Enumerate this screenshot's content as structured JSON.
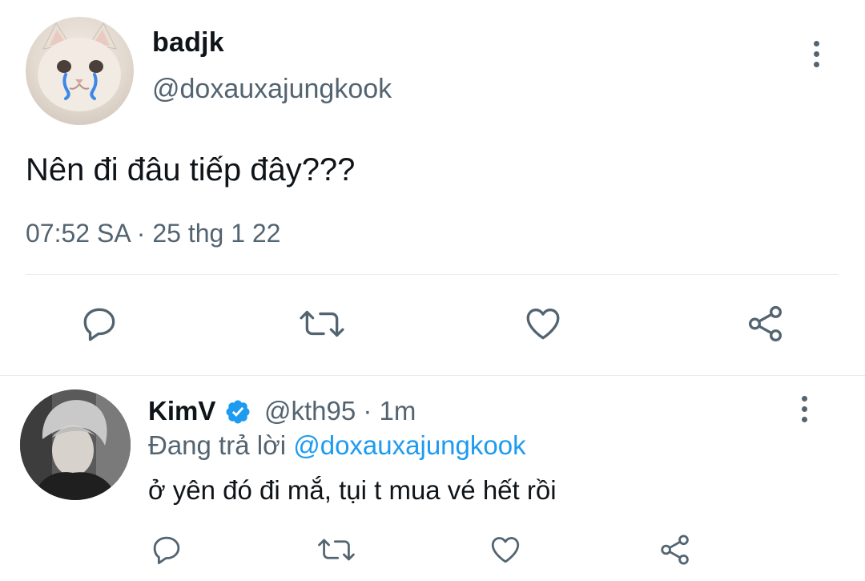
{
  "tweet": {
    "display_name": "badjk",
    "handle": "@doxauxajungkook",
    "text": "Nên đi đâu tiếp đây???",
    "timestamp": "07:52 SA · 25 thg 1 22"
  },
  "reply": {
    "display_name": "KimV",
    "handle_time": "@kth95 · 1m",
    "replying_prefix": "Đang trả lời",
    "replying_to": "@doxauxajungkook",
    "text": "ở yên đó đi mắ, tụi t mua vé hết rồi"
  },
  "icons": {
    "reply": "comment-icon",
    "retweet": "retweet-icon",
    "like": "heart-icon",
    "share": "share-icon",
    "more": "more-vertical-icon",
    "verified": "verified-badge-icon"
  },
  "colors": {
    "icon": "#536471",
    "link": "#1d9bf0",
    "verified": "#1d9bf0"
  }
}
